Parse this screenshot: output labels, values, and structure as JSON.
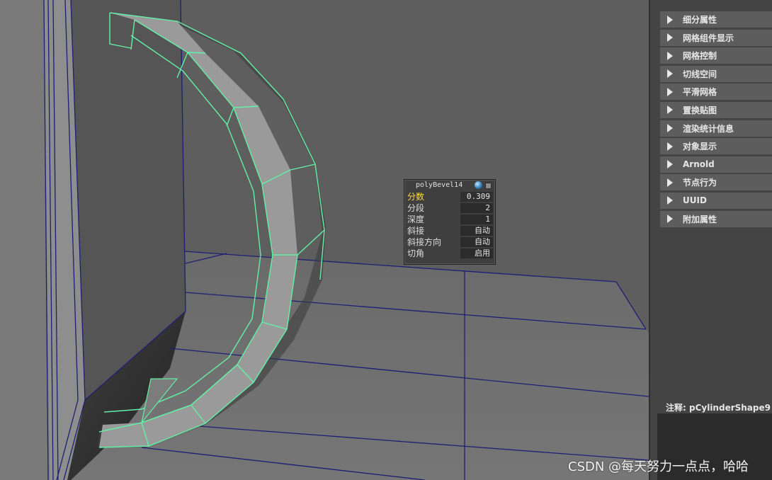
{
  "tool_box": {
    "title": "polyBevel14",
    "rows": [
      {
        "label": "分数",
        "value": "0.309",
        "active": true
      },
      {
        "label": "分段",
        "value": "2"
      },
      {
        "label": "深度",
        "value": "1"
      },
      {
        "label": "斜接",
        "value": "自动"
      },
      {
        "label": "斜接方向",
        "value": "自动"
      },
      {
        "label": "切角",
        "value": "启用"
      }
    ]
  },
  "attribute_editor": {
    "sections": [
      "细分属性",
      "网格组件显示",
      "网格控制",
      "切线空间",
      "平滑网格",
      "置换贴图",
      "渲染统计信息",
      "对象显示",
      "Arnold",
      "节点行为",
      "UUID",
      "附加属性"
    ],
    "notes_label": "注释: ",
    "notes_shape": "pCylinderShape9"
  },
  "watermark": "CSDN @每天努力一点点，哈哈",
  "colors": {
    "wire_highlight": "#63f0a6",
    "grid_line": "#1d1f74",
    "panel_bg": "#444444"
  }
}
